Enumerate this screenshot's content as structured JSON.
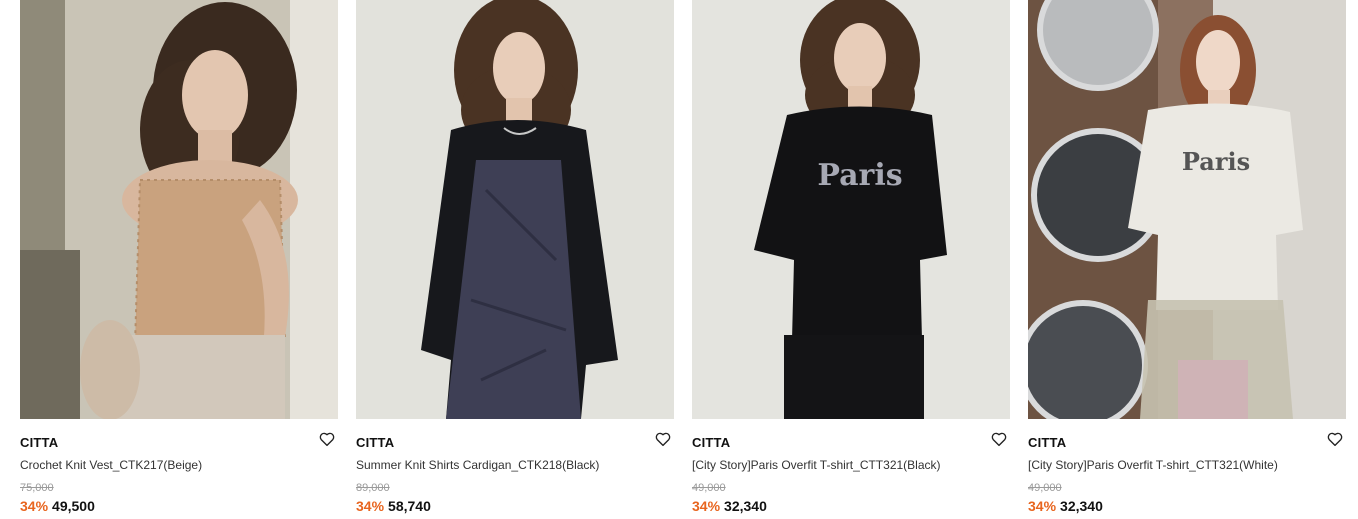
{
  "products": [
    {
      "brand": "CITTA",
      "name": "Crochet Knit Vest_CTK217(Beige)",
      "original_price": "75,000",
      "discount": "34%",
      "price": "49,500",
      "image": "Model in beige crochet knit vest"
    },
    {
      "brand": "CITTA",
      "name": "Summer Knit Shirts Cardigan_CTK218(Black)",
      "original_price": "89,000",
      "discount": "34%",
      "price": "58,740",
      "image": "Model in black knit cardigan over navy dress"
    },
    {
      "brand": "CITTA",
      "name": "[City Story]Paris Overfit T-shirt_CTT321(Black)",
      "original_price": "49,000",
      "discount": "34%",
      "price": "32,340",
      "image": "Model in black Paris print t-shirt",
      "print_text": "Paris"
    },
    {
      "brand": "CITTA",
      "name": "[City Story]Paris Overfit T-shirt_CTT321(White)",
      "original_price": "49,000",
      "discount": "34%",
      "price": "32,340",
      "image": "Model in white Paris print t-shirt",
      "print_text": "Paris"
    }
  ],
  "colors": {
    "discount": "#e8651f",
    "original_price": "#9a9a9a"
  },
  "icons": {
    "wishlist": "heart-outline-icon"
  }
}
